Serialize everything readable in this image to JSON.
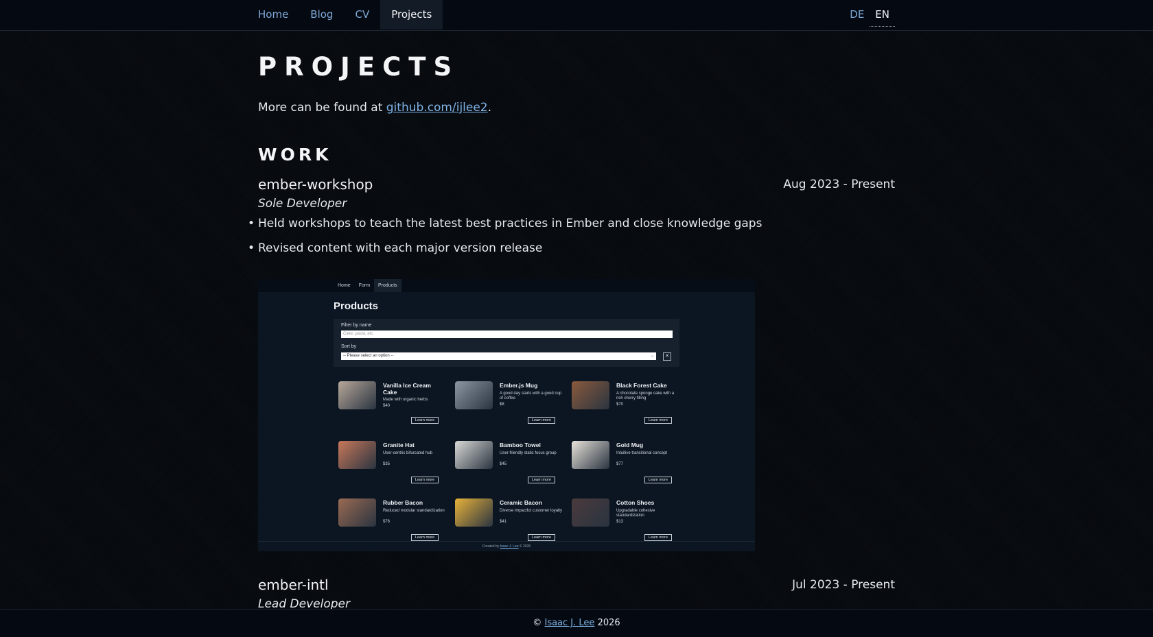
{
  "nav": {
    "items": [
      {
        "label": "Home"
      },
      {
        "label": "Blog"
      },
      {
        "label": "CV"
      },
      {
        "label": "Projects",
        "active": true
      }
    ],
    "languages": [
      {
        "label": "DE"
      },
      {
        "label": "EN",
        "active": true
      }
    ]
  },
  "page": {
    "title": "PROJECTS",
    "intro_prefix": "More can be found at ",
    "intro_link": "github.com/ijlee2",
    "intro_suffix": "."
  },
  "section": {
    "title": "WORK"
  },
  "projects": [
    {
      "name": "ember-workshop",
      "date": "Aug 2023 - Present",
      "role": "Sole Developer",
      "bullets": [
        "Held workshops to teach the latest best practices in Ember and close knowledge gaps",
        "Revised content with each major version release"
      ]
    },
    {
      "name": "ember-intl",
      "date": "Jul 2023 - Present",
      "role": "Lead Developer"
    }
  ],
  "screenshot": {
    "nav": [
      "Home",
      "Form",
      "Products"
    ],
    "title": "Products",
    "filter_label": "Filter by name",
    "filter_placeholder": "Cake, pasta, etc.",
    "sort_label": "Sort by",
    "sort_value": "-- Please select an option --",
    "clear_symbol": "✕",
    "button_label": "Learn more",
    "products": [
      {
        "name": "Vanilla Ice Cream Cake",
        "desc": "Made with organic herbs",
        "price": "$40",
        "color": "#b7a79a"
      },
      {
        "name": "Ember.js Mug",
        "desc": "A good day starts with a good cup of coffee",
        "price": "$8",
        "color": "#8c96a3"
      },
      {
        "name": "Black Forest Cake",
        "desc": "A chocolate sponge cake with a rich cherry filling",
        "price": "$70",
        "color": "#8a5a3c"
      },
      {
        "name": "Granite Hat",
        "desc": "User-centric bifurcated hub",
        "price": "$35",
        "color": "#c8785a"
      },
      {
        "name": "Bamboo Towel",
        "desc": "User-friendly static focus group",
        "price": "$45",
        "color": "#d9d9d6"
      },
      {
        "name": "Gold Mug",
        "desc": "Intuitive transitional concept",
        "price": "$77",
        "color": "#e8e2da"
      },
      {
        "name": "Rubber Bacon",
        "desc": "Reduced modular standardization",
        "price": "$76",
        "color": "#9a6a52"
      },
      {
        "name": "Ceramic Bacon",
        "desc": "Diverse impactful customer loyalty",
        "price": "$41",
        "color": "#e8b23a"
      },
      {
        "name": "Cotton Shoes",
        "desc": "Upgradable cohesive standardization",
        "price": "$13",
        "color": "#4a3a3c"
      }
    ],
    "footer_prefix": "Created by ",
    "footer_link": "Isaac J. Lee",
    "footer_suffix": " © 2026"
  },
  "footer": {
    "copyright": "©",
    "author": "Isaac J. Lee",
    "year": "2026"
  }
}
